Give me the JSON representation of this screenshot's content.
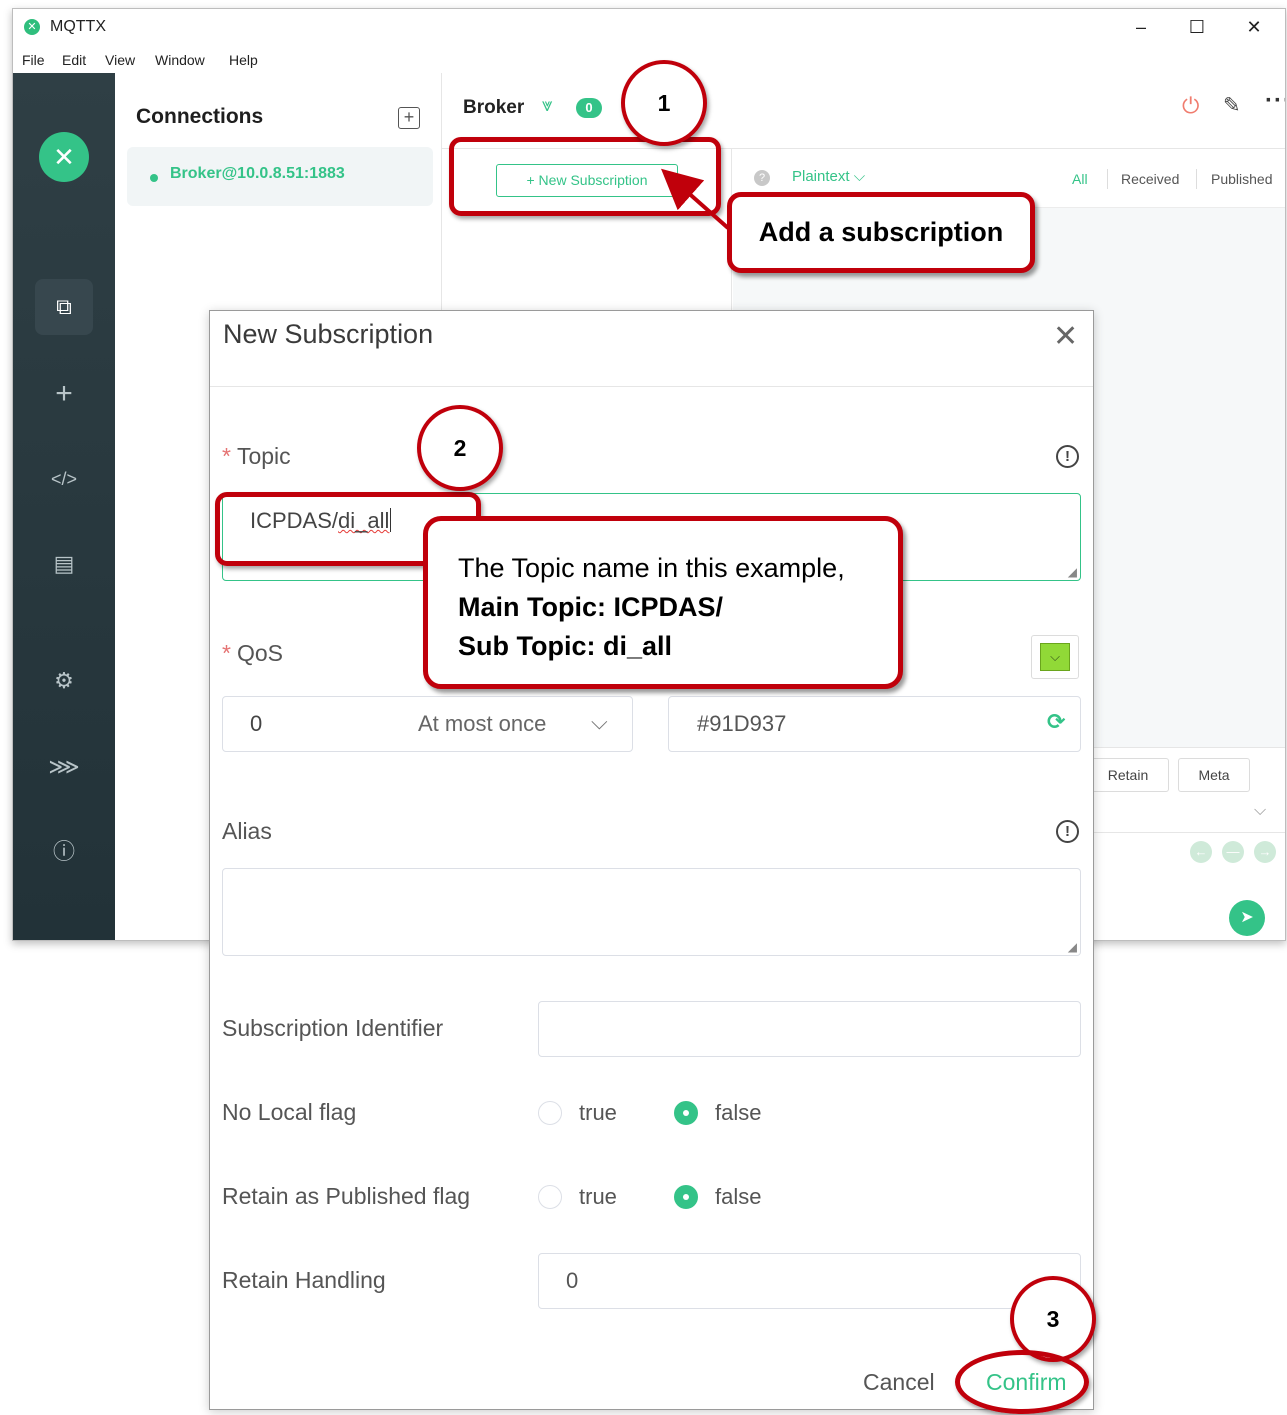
{
  "window": {
    "title": "MQTTX",
    "logo_glyph": "✕",
    "controls": {
      "minimize": "–",
      "maximize": "☐",
      "close": "✕"
    },
    "menu": [
      "File",
      "Edit",
      "View",
      "Window",
      "Help"
    ]
  },
  "sidebar": {
    "logo_glyph": "✕",
    "icons": [
      {
        "name": "connections-icon",
        "glyph": "⧉",
        "active": true
      },
      {
        "name": "new-connection-icon",
        "glyph": "+"
      },
      {
        "name": "script-icon",
        "glyph": "</>"
      },
      {
        "name": "log-icon",
        "glyph": "▤"
      },
      {
        "name": "settings-icon",
        "glyph": "⚙"
      },
      {
        "name": "subscription-feed-icon",
        "glyph": "⋙"
      },
      {
        "name": "about-icon",
        "glyph": "ⓘ"
      }
    ]
  },
  "connections": {
    "title": "Connections",
    "add_glyph": "+",
    "items": [
      {
        "name": "Broker@10.0.8.51:1883",
        "status": "connected"
      }
    ]
  },
  "main_header": {
    "broker_name": "Broker",
    "chevron_glyph": "⩔",
    "subscription_count": "0",
    "power_glyph": "⏻",
    "edit_glyph": "✎",
    "more_glyph": "···"
  },
  "subscriptions": {
    "new_button_label": "+ New Subscription"
  },
  "messages": {
    "help_glyph": "?",
    "payload_type": "Plaintext ⌵",
    "filters": [
      "All",
      "Received",
      "Published"
    ]
  },
  "publish": {
    "chips": [
      "Retain",
      "Meta"
    ],
    "chevron_glyph": "⌵",
    "nav_glyphs": [
      "←",
      "—",
      "→"
    ],
    "send_glyph": "➤"
  },
  "dialog": {
    "title": "New Subscription",
    "close_glyph": "✕",
    "required_mark": "*",
    "info_glyph": "!",
    "topic": {
      "label": "Topic",
      "value_plain": "ICPDAS/",
      "value_spell": "di_all"
    },
    "qos": {
      "label": "QoS",
      "value": "0",
      "description": "At most once",
      "chevron": "⌵"
    },
    "color": {
      "value": "#91D937",
      "swatch": "#91D937",
      "swatch_glyph": "⌵",
      "refresh_glyph": "⟳"
    },
    "alias": {
      "label": "Alias"
    },
    "subscription_identifier": {
      "label": "Subscription Identifier"
    },
    "no_local_flag": {
      "label": "No Local flag",
      "options": [
        "true",
        "false"
      ],
      "selected": "false"
    },
    "retain_as_published_flag": {
      "label": "Retain as Published flag",
      "options": [
        "true",
        "false"
      ],
      "selected": "false"
    },
    "retain_handling": {
      "label": "Retain Handling",
      "value": "0"
    },
    "cancel_label": "Cancel",
    "confirm_label": "Confirm"
  },
  "annotations": {
    "steps": [
      "1",
      "2",
      "3"
    ],
    "callout_1": "Add a subscription",
    "callout_2_line1": "The Topic name in this example,",
    "callout_2_line2": "Main Topic: ICPDAS/",
    "callout_2_line3": "Sub Topic: di_all",
    "accent_color": "#C0000B"
  },
  "colors": {
    "brand_green": "#34C388",
    "sidebar_bg": "#2F3F45",
    "annotation_red": "#C0000B"
  }
}
